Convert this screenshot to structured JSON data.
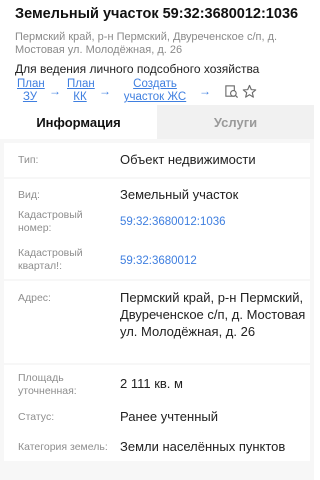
{
  "header": {
    "title": "Земельный участок 59:32:3680012:1036",
    "address": "Пермский край, р-н Пермский, Двуреченское с/п, д. Мостовая ул. Молодёжная, д. 26",
    "purpose": "Для ведения личного подсобного хозяйства"
  },
  "actions": [
    {
      "label": "План ЗУ"
    },
    {
      "label": "План КК"
    },
    {
      "label": "Создать участок ЖС"
    }
  ],
  "icons": [
    "search-document-icon",
    "star-icon"
  ],
  "tabs": [
    {
      "label": "Информация",
      "active": true
    },
    {
      "label": "Услуги",
      "active": false
    }
  ],
  "fields": [
    {
      "label": "Тип:",
      "value": "Объект недвижимости"
    },
    {
      "label": "Вид:",
      "value": "Земельный участок"
    },
    {
      "label": "Кадастровый номер:",
      "value": "59:32:3680012:1036"
    },
    {
      "label": "Кадастровый квартал!:",
      "value": "59:32:3680012"
    },
    {
      "label": "Адрес:",
      "value": "Пермский край, р-н Пермский, Двуреченское с/п, д. Мостовая ул. Молодёжная, д. 26"
    },
    {
      "label": "Площадь уточненная:",
      "value": "2 111 кв. м"
    },
    {
      "label": "Статус:",
      "value": "Ранее учтенный"
    },
    {
      "label": "Категория земель:",
      "value": "Земли населённых пунктов"
    }
  ],
  "colors": {
    "accent": "#3f7fe0",
    "label": "#8e8e8e",
    "background": "#f7f7f7"
  }
}
